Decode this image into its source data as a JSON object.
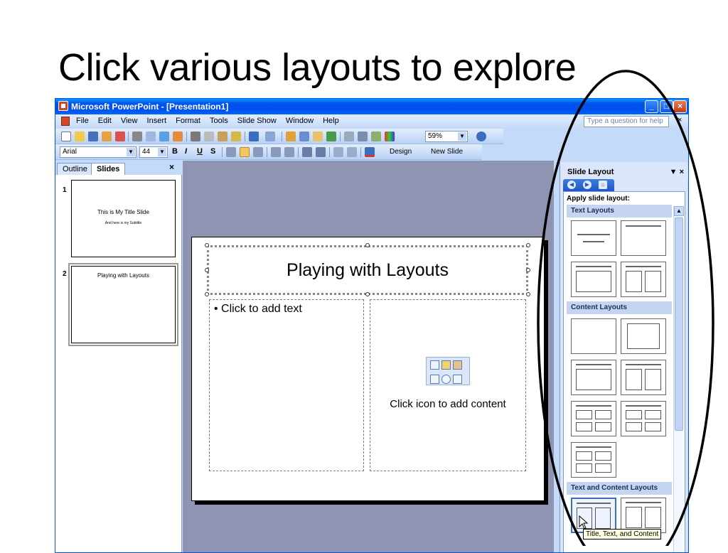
{
  "slide_heading": "Click various layouts to explore",
  "window": {
    "title": "Microsoft PowerPoint - [Presentation1]",
    "buttons": {
      "minimize": "_",
      "maximize": "□",
      "close": "×"
    }
  },
  "menubar": {
    "items": [
      "File",
      "Edit",
      "View",
      "Insert",
      "Format",
      "Tools",
      "Slide Show",
      "Window",
      "Help"
    ],
    "help_placeholder": "Type a question for help",
    "close_glyph": "×"
  },
  "standard_toolbar": {
    "zoom": "59%"
  },
  "formatting_toolbar": {
    "font": "Arial",
    "font_size": "44",
    "bold": "B",
    "italic": "I",
    "underline": "U",
    "shadow": "S",
    "design_label": "Design",
    "new_slide_label": "New Slide"
  },
  "left_panel": {
    "tabs": [
      "Outline",
      "Slides"
    ],
    "active_tab": "Slides",
    "close_glyph": "×",
    "slides": [
      {
        "number": "1",
        "title": "This is My Title Slide",
        "subtitle": "And here is my Subtitle"
      },
      {
        "number": "2",
        "title": "Playing with Layouts"
      }
    ]
  },
  "slide": {
    "title": "Playing with Layouts",
    "bullet_text": "Click to add text",
    "content_prompt": "Click icon to add content"
  },
  "task_pane": {
    "title": "Slide Layout",
    "dropdown_glyph": "▼",
    "close_glyph": "×",
    "apply_label": "Apply slide layout:",
    "sections": [
      "Text Layouts",
      "Content Layouts",
      "Text and Content Layouts"
    ],
    "tooltip": "Title, Text, and Content"
  },
  "colors": {
    "titlebar_blue": "#0053ee",
    "workspace_gray": "#8e94b1",
    "taskpane_section": "#c5d5f1",
    "office_chrome": "#c3daf9"
  }
}
